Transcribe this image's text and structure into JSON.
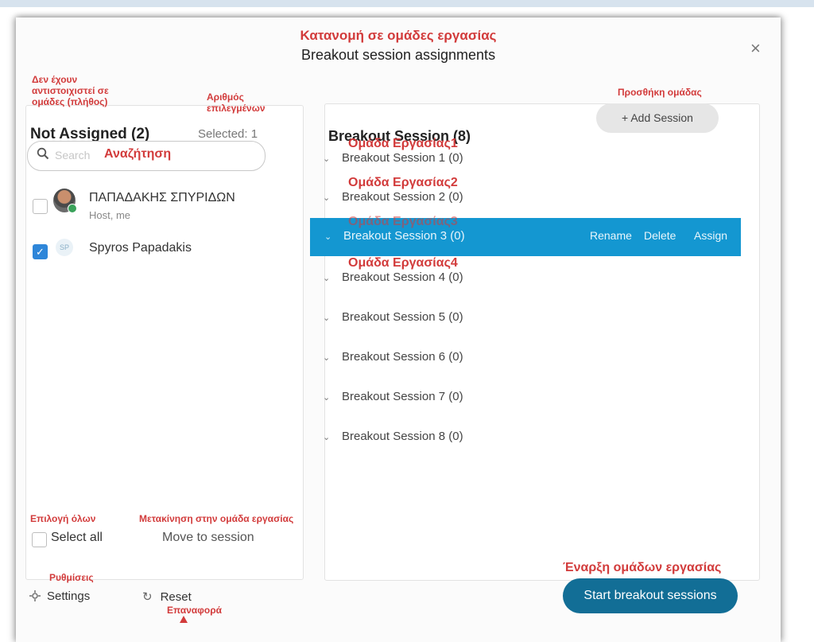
{
  "dialog": {
    "title_greek": "Κατανομή σε ομάδες εργασίας",
    "title": "Breakout session assignments",
    "close_symbol": "×"
  },
  "left": {
    "anno_not_assigned": "Δεν έχουν αντιστοιχιστεί σε ομάδες (πλήθος)",
    "anno_selected_count": "Αριθμός επιλεγμένων",
    "title": "Not Assigned (2)",
    "selected": "Selected: 1",
    "search": {
      "placeholder": "Search",
      "anno": "Αναζήτηση",
      "icon": "search-icon"
    },
    "participants": [
      {
        "name": "ΠΑΠΑΔΑΚΗΣ ΣΠΥΡΙΔΩΝ",
        "sub": "Host, me",
        "checked": false
      },
      {
        "name": "Spyros Papadakis",
        "initials": "SP",
        "checked": true
      }
    ],
    "anno_select_all": "Επιλογή όλων",
    "select_all": "Select all",
    "anno_move": "Μετακίνηση στην ομάδα εργασίας",
    "move": "Move to session"
  },
  "right": {
    "title": "Breakout Session  (8)",
    "anno_add": "Προσθήκη ομάδας",
    "add_button": "+ Add Session",
    "sessions": [
      {
        "label": "Breakout Session 1 (0)",
        "anno": "Ομάδα Εργασίας1"
      },
      {
        "label": "Breakout Session 2 (0)",
        "anno": "Ομάδα Εργασίας2"
      },
      {
        "label": "Breakout Session 3 (0)",
        "anno": "Ομάδα Εργασίας3",
        "selected": true
      },
      {
        "label": "Breakout Session 4 (0)",
        "anno": "Ομάδα Εργασίας4"
      },
      {
        "label": "Breakout Session 5 (0)"
      },
      {
        "label": "Breakout Session 6 (0)"
      },
      {
        "label": "Breakout Session 7 (0)"
      },
      {
        "label": "Breakout Session 8 (0)"
      }
    ],
    "row_actions": {
      "rename": "Rename",
      "delete": "Delete",
      "assign": "Assign"
    },
    "chevron": "⌄"
  },
  "footer": {
    "anno_settings": "Ρυθμίσεις",
    "settings": "Settings",
    "reset": "Reset",
    "anno_reset": "Επαναφορά",
    "anno_start": "Έναρξη ομάδων εργασίας",
    "start": "Start breakout sessions"
  },
  "colors": {
    "accent": "#1497d1",
    "primary_button": "#126e96",
    "annotation": "#d23b3b",
    "check": "#2e86d9"
  }
}
